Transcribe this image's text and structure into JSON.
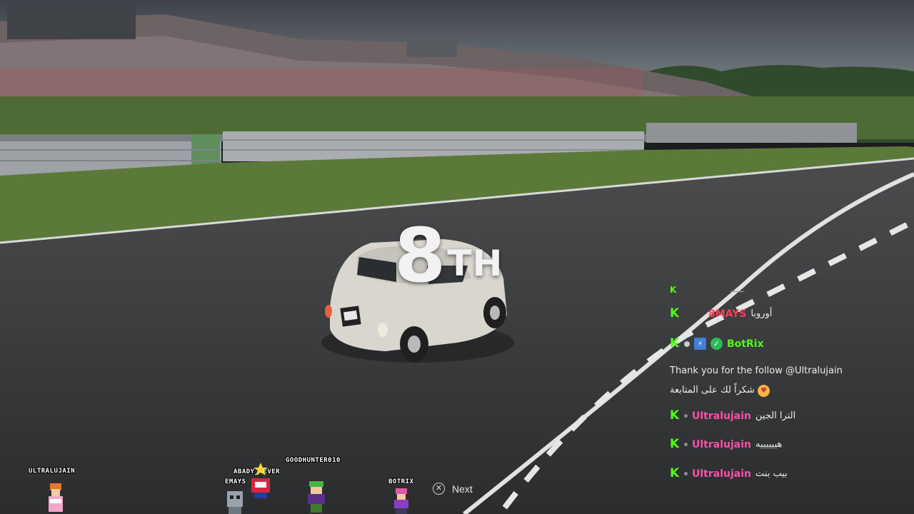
{
  "race": {
    "position_number": "8",
    "position_suffix": "TH"
  },
  "prompt": {
    "button_glyph": "✕",
    "next_label": "Next"
  },
  "chat": {
    "brand_icon": "K",
    "top_fragment": "ـــــ",
    "messages": [
      {
        "username": "8MAYS",
        "text": "أوروبا",
        "user_color": "#ff3d5a"
      },
      {
        "username": "BotRix",
        "text": "",
        "user_color": "#53fc18"
      },
      {
        "username": "Ultralujain",
        "text": "الترا الجين",
        "user_color": "#ff4fa8"
      },
      {
        "username": "Ultralujain",
        "text": "هييييييه",
        "user_color": "#ff4fa8"
      },
      {
        "username": "Ultralujain",
        "text": "بيب بنت",
        "user_color": "#ff4fa8"
      }
    ],
    "bot_message_en": "Thank you for the follow @Ultralujain",
    "bot_message_ar": "شكراً لك على المتابعة"
  },
  "avatars": [
    {
      "name": "ULTRALUJAIN"
    },
    {
      "name": "EMAYS"
    },
    {
      "name": "ABADY_4EVER"
    },
    {
      "name": "GOODHUNTER010"
    },
    {
      "name": "BOTRIX"
    }
  ],
  "icons": {
    "chat_brand": "kick-logo-icon",
    "badge_1": "diamond-badge-icon",
    "badge_2": "bot-badge-icon",
    "badge_3": "verified-badge-icon",
    "emoji": "heart-eyes-emoji-icon"
  },
  "colors": {
    "kick_green": "#53fc18",
    "position_text": "#f2f2f2"
  }
}
